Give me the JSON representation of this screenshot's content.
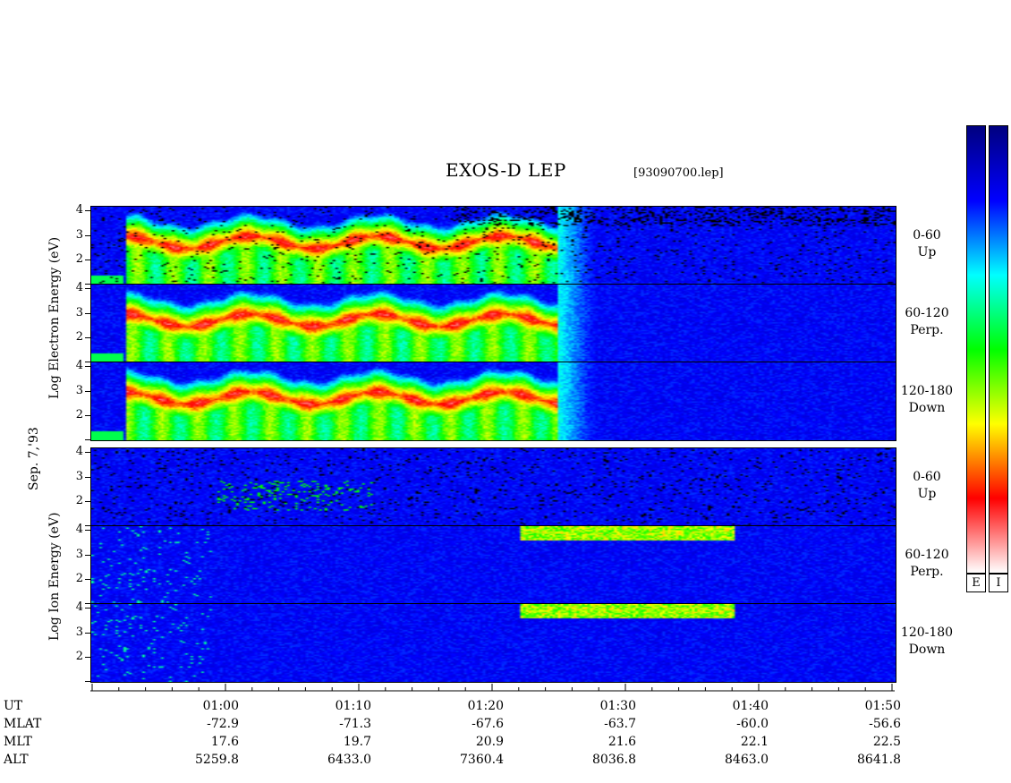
{
  "title": "EXOS-D LEP",
  "file_label": "[93090700.lep]",
  "date_label": "Sep. 7,'93",
  "electron_ylabel": "Log  Electron  Energy (eV)",
  "ion_ylabel": "Log  Ion  Energy (eV)",
  "colorbar_labels": [
    "E",
    "I"
  ],
  "chart_data": {
    "type": "heatmap",
    "title": "EXOS-D LEP",
    "y_ticks": [
      1,
      2,
      3,
      4
    ],
    "y_tick_labels": [
      "2",
      "3",
      "4"
    ],
    "ylim": [
      1,
      4.2
    ],
    "x_range": [
      "00:50",
      "01:50"
    ],
    "panels": [
      {
        "group": "Electron",
        "pitch": "0-60",
        "dir": "Up"
      },
      {
        "group": "Electron",
        "pitch": "60-120",
        "dir": "Perp."
      },
      {
        "group": "Electron",
        "pitch": "120-180",
        "dir": "Down"
      },
      {
        "group": "Ion",
        "pitch": "0-60",
        "dir": "Up"
      },
      {
        "group": "Ion",
        "pitch": "60-120",
        "dir": "Perp."
      },
      {
        "group": "Ion",
        "pitch": "120-180",
        "dir": "Down"
      }
    ],
    "row_labels": [
      "UT",
      "MLAT",
      "MLT",
      "ALT"
    ],
    "columns": [
      {
        "UT": "01:00",
        "MLAT": "-72.9",
        "MLT": "17.6",
        "ALT": "5259.8"
      },
      {
        "UT": "01:10",
        "MLAT": "-71.3",
        "MLT": "19.7",
        "ALT": "6433.0"
      },
      {
        "UT": "01:20",
        "MLAT": "-67.6",
        "MLT": "20.9",
        "ALT": "7360.4"
      },
      {
        "UT": "01:30",
        "MLAT": "-63.7",
        "MLT": "21.6",
        "ALT": "8036.8"
      },
      {
        "UT": "01:40",
        "MLAT": "-60.0",
        "MLT": "22.1",
        "ALT": "8463.0"
      },
      {
        "UT": "01:50",
        "MLAT": "-56.6",
        "MLT": "22.5",
        "ALT": "8641.8"
      }
    ],
    "colorscale": [
      "#ffffff",
      "#ff0000",
      "#ffff00",
      "#00ff00",
      "#00ffff",
      "#0000ff",
      "#00007f"
    ]
  }
}
